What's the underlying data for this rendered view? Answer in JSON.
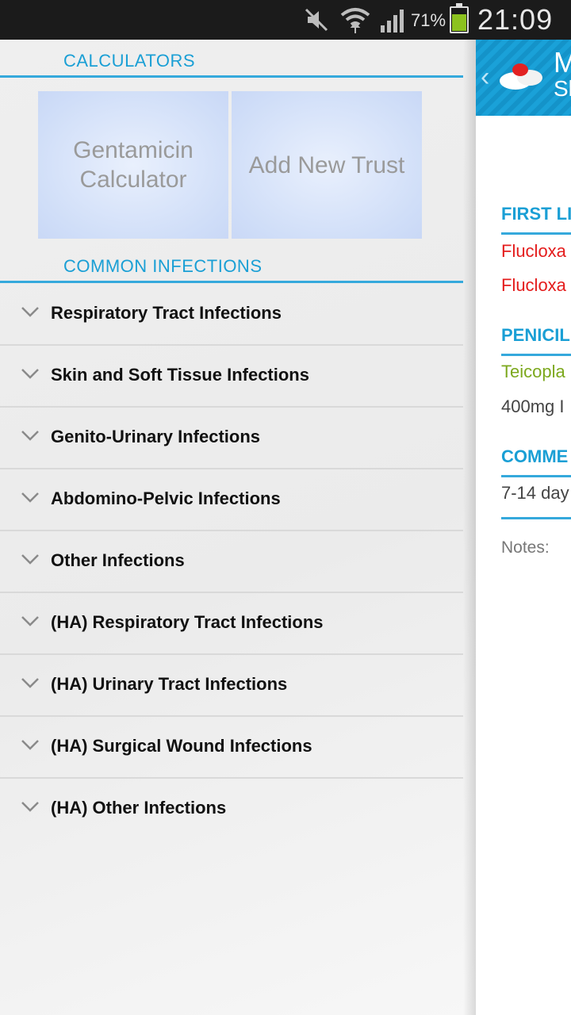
{
  "status_bar": {
    "battery_percent": "71%",
    "time": "21:09",
    "icons": [
      "mute-icon",
      "wifi-icon",
      "signal-icon",
      "battery-icon"
    ],
    "battery_color": "#8cc21f"
  },
  "content": {
    "title": "M",
    "subtitle": "Sk",
    "back_icon": "chevron-left-icon",
    "logo": "pill-logo",
    "sections": [
      {
        "heading": "FIRST LI",
        "lines": [
          "Flucloxa",
          "Flucloxa"
        ]
      },
      {
        "heading": "PENICIL",
        "lines": [
          "Teicopla",
          "400mg I"
        ]
      },
      {
        "heading": "COMME",
        "lines": [
          "7-14 day"
        ]
      }
    ],
    "notes_label": "Notes:"
  },
  "drawer": {
    "calculators_heading": "CALCULATORS",
    "tiles": [
      {
        "line1": "Gentamicin",
        "line2": "Calculator"
      },
      {
        "line1": "Add New Trust",
        "line2": ""
      }
    ],
    "infections_heading": "COMMON INFECTIONS",
    "items": [
      {
        "label": "Respiratory Tract Infections"
      },
      {
        "label": "Skin and Soft Tissue Infections"
      },
      {
        "label": "Genito-Urinary Infections"
      },
      {
        "label": "Abdomino-Pelvic Infections"
      },
      {
        "label": "Other Infections"
      },
      {
        "label": "(HA) Respiratory Tract Infections"
      },
      {
        "label": "(HA) Urinary Tract Infections"
      },
      {
        "label": "(HA) Surgical Wound Infections"
      },
      {
        "label": "(HA) Other Infections"
      }
    ]
  },
  "colors": {
    "accent": "#1a9fd5",
    "red_text": "#e41c1c",
    "green_text": "#7ca81d",
    "tile_bg": "#d0def8"
  }
}
